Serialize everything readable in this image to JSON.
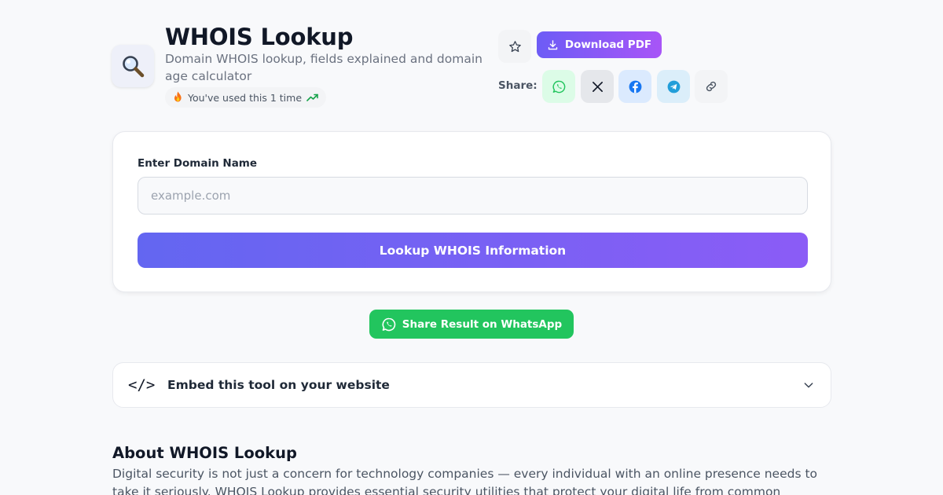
{
  "header": {
    "title": "WHOIS Lookup",
    "subtitle": "Domain WHOIS lookup, fields explained and domain age calculator",
    "usage": "You've used this 1 time",
    "tool_icon": "magnifier-icon"
  },
  "actions": {
    "download_label": "Download PDF",
    "share_label": "Share:",
    "share_targets": [
      "whatsapp",
      "x",
      "facebook",
      "telegram",
      "copy-link"
    ]
  },
  "form": {
    "domain_label": "Enter Domain Name",
    "domain_placeholder": "example.com",
    "domain_value": "",
    "submit_label": "Lookup WHOIS Information"
  },
  "whatsapp_share_label": "Share Result on WhatsApp",
  "embed": {
    "code_symbol": "</>",
    "title": "Embed this tool on your website"
  },
  "about": {
    "title": "About WHOIS Lookup",
    "text": "Digital security is not just a concern for technology companies — every individual with an online presence needs to take it seriously. WHOIS Lookup provides essential security utilities that protect your digital life from common vulnerabilities."
  },
  "colors": {
    "accent_start": "#6366f1",
    "accent_end": "#8b5cf6",
    "whatsapp": "#22c55e",
    "facebook": "#1877f2",
    "telegram": "#229ed9"
  }
}
